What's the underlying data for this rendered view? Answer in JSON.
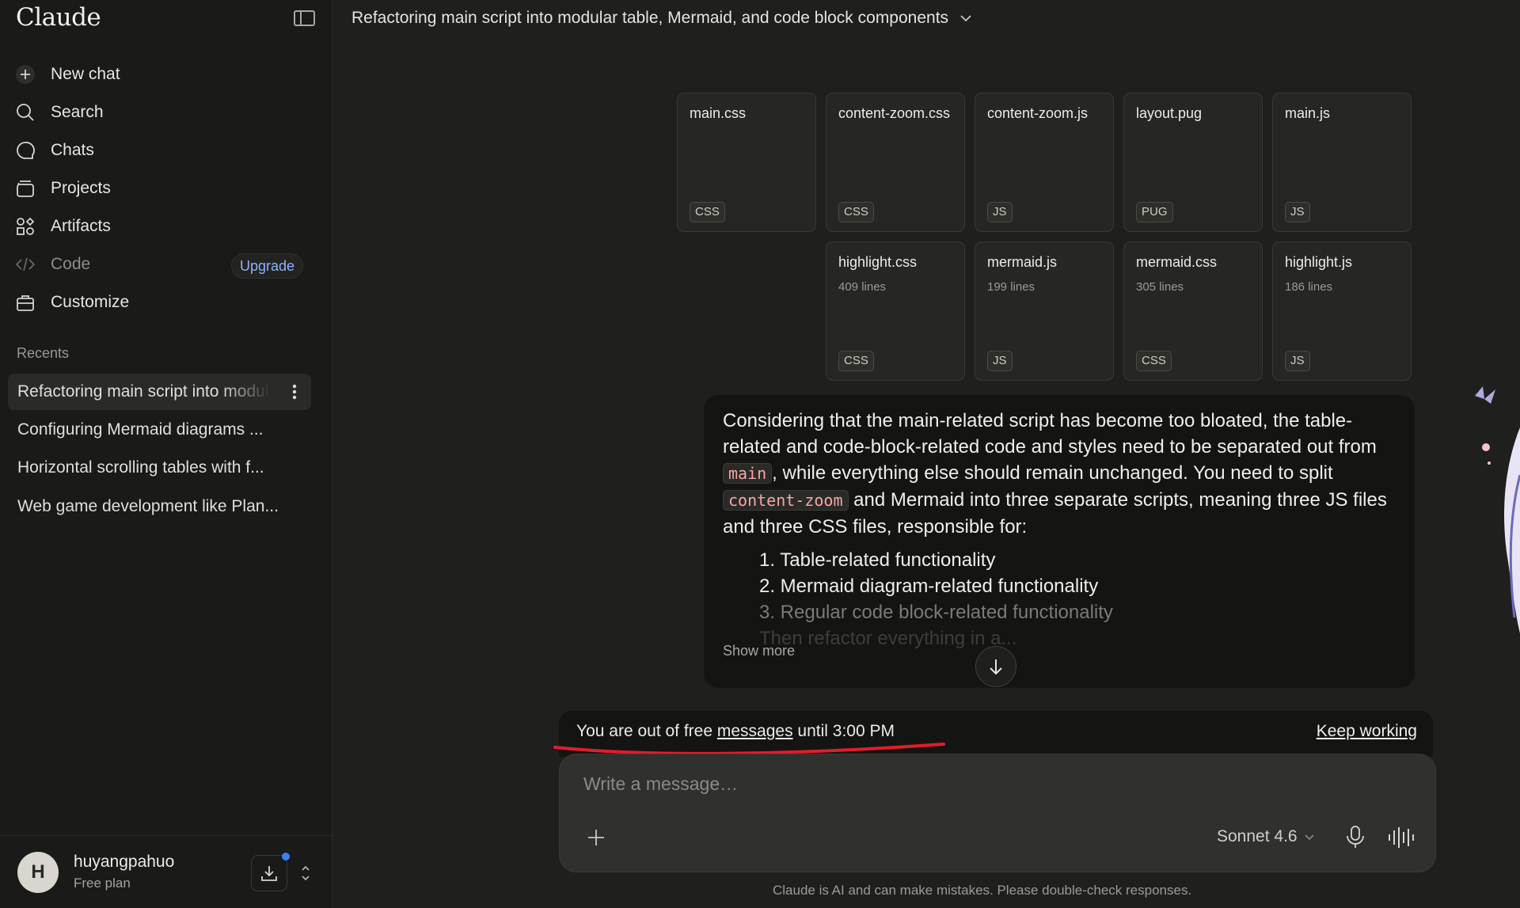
{
  "app": {
    "brand": "Claude"
  },
  "sidebar": {
    "nav": [
      {
        "label": "New chat",
        "icon": "plus-icon"
      },
      {
        "label": "Search",
        "icon": "search-icon"
      },
      {
        "label": "Chats",
        "icon": "chat-bubble-icon"
      },
      {
        "label": "Projects",
        "icon": "folder-icon"
      },
      {
        "label": "Artifacts",
        "icon": "artifacts-icon"
      },
      {
        "label": "Code",
        "icon": "code-icon"
      },
      {
        "label": "Customize",
        "icon": "briefcase-icon"
      }
    ],
    "upgrade_label": "Upgrade",
    "recents_label": "Recents",
    "recents": [
      "Refactoring main script into modular table, Mermaid, and code block components",
      "Configuring Mermaid diagrams ...",
      "Horizontal scrolling tables with f...",
      "Web game development like Plan..."
    ],
    "user": {
      "initial": "H",
      "name": "huyangpahuo",
      "plan": "Free plan"
    }
  },
  "main": {
    "title": "Refactoring main script into modular table, Mermaid, and code block components",
    "files": [
      {
        "name": "main.css",
        "lines": "",
        "type": "CSS"
      },
      {
        "name": "content-zoom.css",
        "lines": "",
        "type": "CSS"
      },
      {
        "name": "content-zoom.js",
        "lines": "",
        "type": "JS"
      },
      {
        "name": "layout.pug",
        "lines": "",
        "type": "PUG"
      },
      {
        "name": "main.js",
        "lines": "",
        "type": "JS"
      },
      {
        "name": "highlight.css",
        "lines": "409 lines",
        "type": "CSS"
      },
      {
        "name": "mermaid.js",
        "lines": "199 lines",
        "type": "JS"
      },
      {
        "name": "mermaid.css",
        "lines": "305 lines",
        "type": "CSS"
      },
      {
        "name": "highlight.js",
        "lines": "186 lines",
        "type": "JS"
      }
    ],
    "message": {
      "part1": "Considering that the main-related script has become too bloated, the table-related and code-block-related code and styles need to be separated out from",
      "code1": "main",
      "part2": ", while everything else should remain unchanged. You need to split",
      "code2": "content-zoom",
      "part3": "and Mermaid into three separate scripts, meaning three JS files and three CSS files, responsible for:",
      "list": [
        "1. Table-related functionality",
        "2. Mermaid diagram-related functionality",
        "3. Regular code block-related functionality",
        "Then refactor everything in a..."
      ],
      "show_more": "Show more"
    },
    "limit": {
      "text_before": "You are out of free ",
      "text_link": "messages",
      "text_after": " until 3:00 PM",
      "keep_working": "Keep working"
    },
    "composer": {
      "placeholder": "Write a message…",
      "model": "Sonnet 4.6"
    },
    "disclaimer": "Claude is AI and can make mistakes. Please double-check responses."
  }
}
